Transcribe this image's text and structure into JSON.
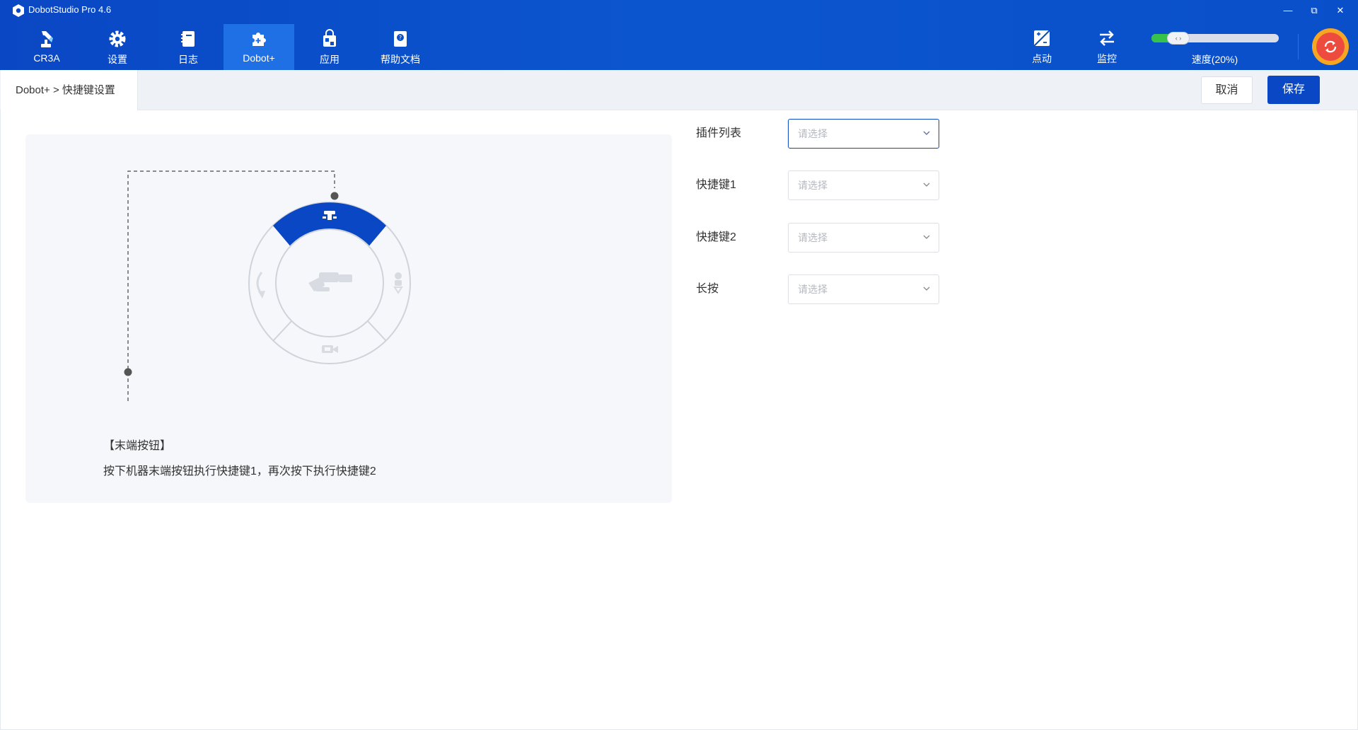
{
  "app": {
    "title": "DobotStudio Pro 4.6",
    "window_controls": {
      "minimize": "—",
      "restore": "⧉",
      "close": "✕"
    }
  },
  "nav": [
    {
      "label": "CR3A",
      "icon": "robot-arm-icon",
      "active": false
    },
    {
      "label": "设置",
      "icon": "gear-icon",
      "active": false
    },
    {
      "label": "日志",
      "icon": "log-book-icon",
      "active": false
    },
    {
      "label": "Dobot+",
      "icon": "puzzle-icon",
      "active": true
    },
    {
      "label": "应用",
      "icon": "app-bag-icon",
      "active": false
    },
    {
      "label": "帮助文档",
      "icon": "help-doc-icon",
      "active": false
    }
  ],
  "tools": {
    "jog": {
      "label": "点动",
      "icon": "jog-icon"
    },
    "monitor": {
      "label": "监控",
      "icon": "swap-arrows-icon"
    }
  },
  "speed": {
    "label": "速度(20%)",
    "value_percent": 20,
    "thumb_text": "‹ ›"
  },
  "colors": {
    "brand": "#0a47c4",
    "speed_fill": "#37c24b",
    "power_outer": "#f6a623",
    "power_inner": "#ee4b3f"
  },
  "breadcrumb": "Dobot+ > 快捷键设置",
  "actions": {
    "cancel": "取消",
    "save": "保存"
  },
  "panel": {
    "desc_title": "【末端按钮】",
    "desc_text": "按下机器末端按钮执行快捷键1，再次按下执行快捷键2"
  },
  "form": {
    "rows": [
      {
        "label": "插件列表",
        "placeholder": "请选择",
        "focused": true
      },
      {
        "label": "快捷键1",
        "placeholder": "请选择",
        "focused": false
      },
      {
        "label": "快捷键2",
        "placeholder": "请选择",
        "focused": false
      },
      {
        "label": "长按",
        "placeholder": "请选择",
        "focused": false
      }
    ]
  }
}
